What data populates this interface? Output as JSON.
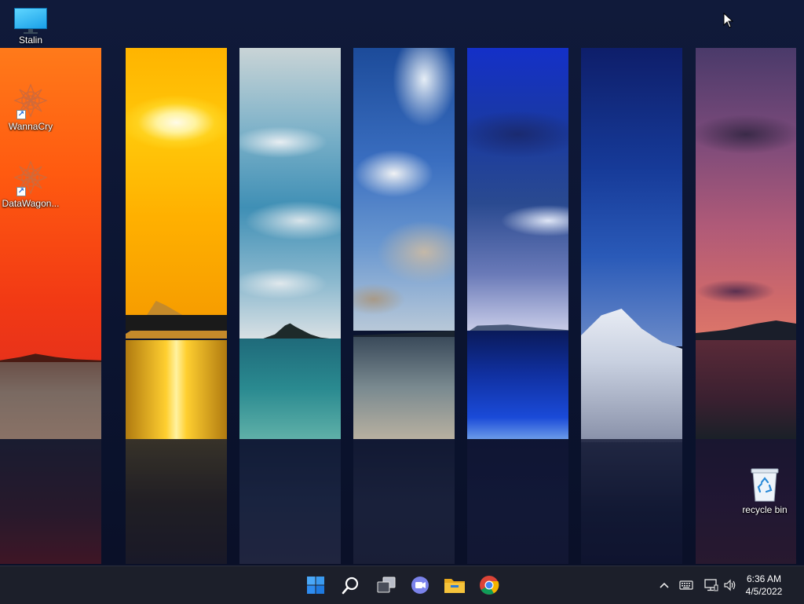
{
  "desktop": {
    "icons": [
      {
        "label": "Stalin"
      },
      {
        "label": "WannaCry"
      },
      {
        "label": "DataWagon..."
      },
      {
        "label": "recycle bin"
      }
    ]
  },
  "taskbar": {
    "apps": [
      "start-icon",
      "search-icon",
      "task-view-icon",
      "chat-icon",
      "file-explorer-icon",
      "chrome-icon"
    ],
    "tray": [
      "chevron-up-icon",
      "keyboard-icon",
      "network-icon",
      "volume-icon"
    ],
    "clock": {
      "time": "6:36 AM",
      "date": "4/5/2022"
    }
  },
  "colors": {
    "taskbar_bg": "#1c1f2a",
    "start_blue": "#2e8cf0",
    "folder_yellow": "#f5c33b"
  }
}
